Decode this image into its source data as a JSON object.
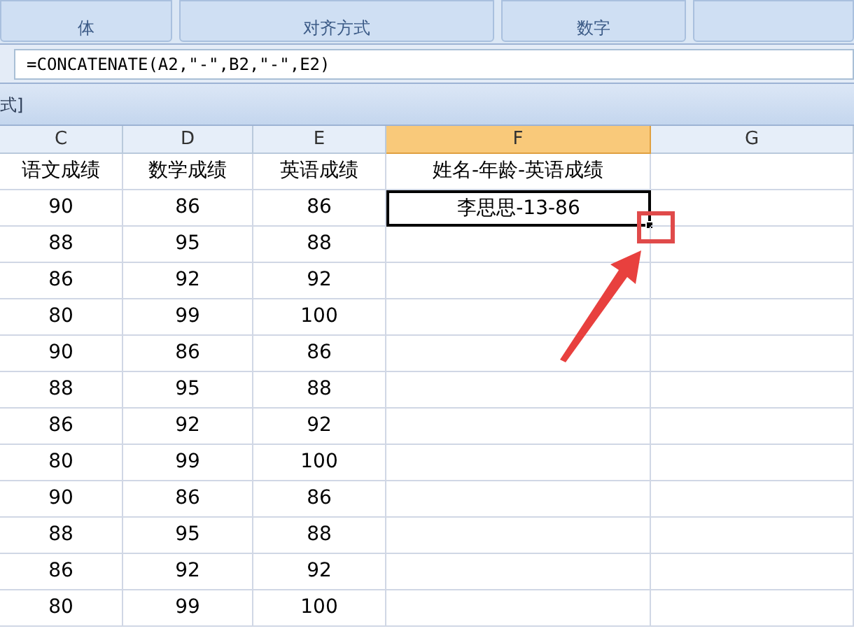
{
  "ribbon": {
    "groups": [
      {
        "label": "体"
      },
      {
        "label": "对齐方式"
      },
      {
        "label": "数字"
      }
    ]
  },
  "formula_bar": {
    "formula": "=CONCATENATE(A2,\"-\",B2,\"-\",E2)"
  },
  "title_strip": {
    "text": "式]"
  },
  "columns": [
    {
      "label": "C",
      "selected": false
    },
    {
      "label": "D",
      "selected": false
    },
    {
      "label": "E",
      "selected": false
    },
    {
      "label": "F",
      "selected": true
    },
    {
      "label": "G",
      "selected": false
    }
  ],
  "rows": [
    {
      "cells": [
        "语文成绩",
        "数学成绩",
        "英语成绩",
        "姓名-年龄-英语成绩",
        ""
      ],
      "selected_cell": false
    },
    {
      "cells": [
        "90",
        "86",
        "86",
        "李思思-13-86",
        ""
      ],
      "selected_cell": true
    },
    {
      "cells": [
        "88",
        "95",
        "88",
        "",
        ""
      ],
      "selected_cell": false
    },
    {
      "cells": [
        "86",
        "92",
        "92",
        "",
        ""
      ],
      "selected_cell": false
    },
    {
      "cells": [
        "80",
        "99",
        "100",
        "",
        ""
      ],
      "selected_cell": false
    },
    {
      "cells": [
        "90",
        "86",
        "86",
        "",
        ""
      ],
      "selected_cell": false
    },
    {
      "cells": [
        "88",
        "95",
        "88",
        "",
        ""
      ],
      "selected_cell": false
    },
    {
      "cells": [
        "86",
        "92",
        "92",
        "",
        ""
      ],
      "selected_cell": false
    },
    {
      "cells": [
        "80",
        "99",
        "100",
        "",
        ""
      ],
      "selected_cell": false
    },
    {
      "cells": [
        "90",
        "86",
        "86",
        "",
        ""
      ],
      "selected_cell": false
    },
    {
      "cells": [
        "88",
        "95",
        "88",
        "",
        ""
      ],
      "selected_cell": false
    },
    {
      "cells": [
        "86",
        "92",
        "92",
        "",
        ""
      ],
      "selected_cell": false
    },
    {
      "cells": [
        "80",
        "99",
        "100",
        "",
        ""
      ],
      "selected_cell": false
    }
  ]
}
